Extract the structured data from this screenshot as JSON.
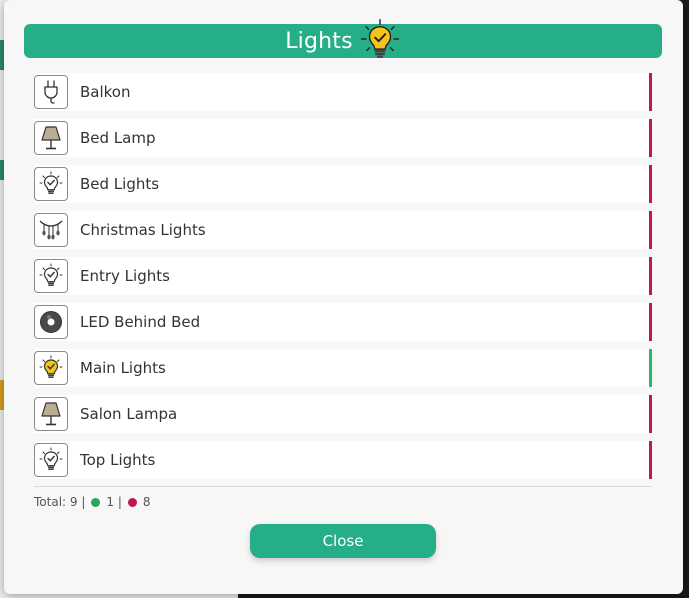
{
  "dialog": {
    "title": "Lights",
    "close_label": "Close"
  },
  "items": [
    {
      "label": "Balkon",
      "icon": "plug-icon",
      "state": "off"
    },
    {
      "label": "Bed Lamp",
      "icon": "table-lamp-icon",
      "state": "off"
    },
    {
      "label": "Bed Lights",
      "icon": "lightbulb-icon",
      "state": "off"
    },
    {
      "label": "Christmas Lights",
      "icon": "string-lights-icon",
      "state": "off"
    },
    {
      "label": "Entry Lights",
      "icon": "lightbulb-icon",
      "state": "off"
    },
    {
      "label": "LED Behind Bed",
      "icon": "led-ring-icon",
      "state": "off"
    },
    {
      "label": "Main Lights",
      "icon": "lightbulb-on-icon",
      "state": "on"
    },
    {
      "label": "Salon Lampa",
      "icon": "table-lamp-icon",
      "state": "off"
    },
    {
      "label": "Top Lights",
      "icon": "lightbulb-icon",
      "state": "off"
    }
  ],
  "summary": {
    "total_text": "Total: 9 |",
    "on_count": "1 |",
    "off_count": "8"
  },
  "colors": {
    "accent": "#26ae88",
    "on": "#2fb36e",
    "off": "#c0184a"
  }
}
